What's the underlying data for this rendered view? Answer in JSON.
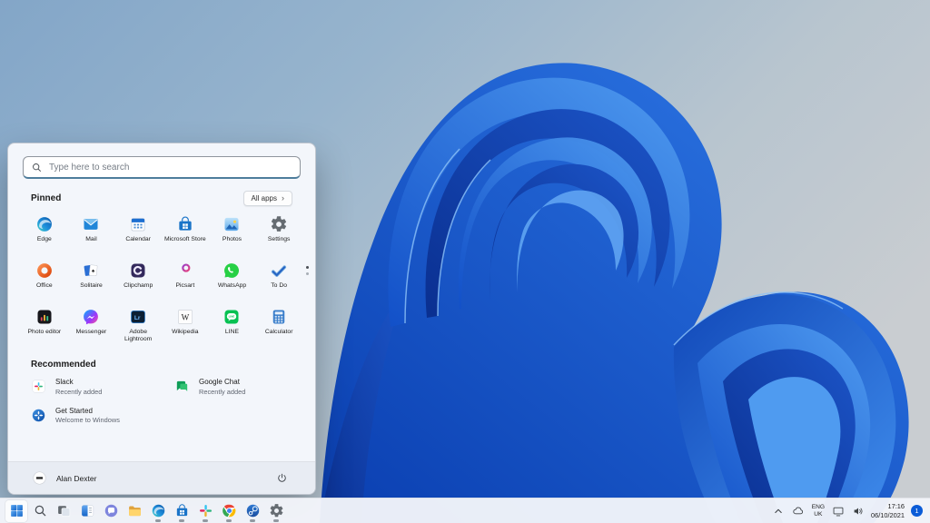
{
  "wallpaper": {
    "description": "Windows 11 blue bloom on steel-blue gradient",
    "background_top_left": "#83a6c8",
    "background_bottom_right": "#c9cdd1",
    "bloom_blue": "#1e5fd6"
  },
  "start_menu": {
    "search": {
      "placeholder": "Type here to search",
      "icon": "search"
    },
    "pinned": {
      "label": "Pinned",
      "all_apps": {
        "label": "All apps",
        "chevron": "›"
      },
      "apps": [
        {
          "name": "Edge",
          "icon": "edge"
        },
        {
          "name": "Mail",
          "icon": "mail"
        },
        {
          "name": "Calendar",
          "icon": "calendar"
        },
        {
          "name": "Microsoft Store",
          "icon": "store"
        },
        {
          "name": "Photos",
          "icon": "photos"
        },
        {
          "name": "Settings",
          "icon": "settings"
        },
        {
          "name": "Office",
          "icon": "office"
        },
        {
          "name": "Solitaire",
          "icon": "solitaire"
        },
        {
          "name": "Clipchamp",
          "icon": "clipchamp"
        },
        {
          "name": "Picsart",
          "icon": "picsart"
        },
        {
          "name": "WhatsApp",
          "icon": "whatsapp"
        },
        {
          "name": "To Do",
          "icon": "todo"
        },
        {
          "name": "Photo editor",
          "icon": "photo-editor"
        },
        {
          "name": "Messenger",
          "icon": "messenger"
        },
        {
          "name": "Adobe Lightroom",
          "icon": "lightroom",
          "two_line": true
        },
        {
          "name": "Wikipedia",
          "icon": "wikipedia"
        },
        {
          "name": "LINE",
          "icon": "line"
        },
        {
          "name": "Calculator",
          "icon": "calculator"
        }
      ],
      "page_count": 2,
      "active_page": 1
    },
    "recommended": {
      "label": "Recommended",
      "items": [
        {
          "title": "Slack",
          "subtitle": "Recently added",
          "icon": "slack-tile"
        },
        {
          "title": "Google Chat",
          "subtitle": "Recently added",
          "icon": "gchat"
        },
        {
          "title": "Get Started",
          "subtitle": "Welcome to Windows",
          "icon": "get-started"
        }
      ]
    },
    "user": {
      "name": "Alan Dexter",
      "avatar_icon": "avatar",
      "power_icon": "power"
    }
  },
  "taskbar": {
    "buttons": [
      {
        "name": "start",
        "icon": "start",
        "active": true
      },
      {
        "name": "search",
        "icon": "search"
      },
      {
        "name": "task-view",
        "icon": "taskview"
      },
      {
        "name": "widgets",
        "icon": "widgets"
      },
      {
        "name": "chat",
        "icon": "chat"
      },
      {
        "name": "file-explorer",
        "icon": "explorer"
      },
      {
        "name": "edge",
        "icon": "edge",
        "running": true
      },
      {
        "name": "microsoft-store",
        "icon": "store",
        "running": true
      },
      {
        "name": "slack",
        "icon": "slack",
        "running": true
      },
      {
        "name": "chrome",
        "icon": "chrome",
        "running": true
      },
      {
        "name": "steam",
        "icon": "steam",
        "running": true
      },
      {
        "name": "settings",
        "icon": "settings",
        "running": true
      }
    ],
    "tray": {
      "chevron_icon": "chevron-up",
      "onedrive_icon": "cloud",
      "language": {
        "line1": "ENG",
        "line2": "UK"
      },
      "network_icon": "network",
      "volume_icon": "volume",
      "clock": {
        "time": "17:16",
        "date": "06/10/2021"
      },
      "notification_badge": "1"
    }
  }
}
